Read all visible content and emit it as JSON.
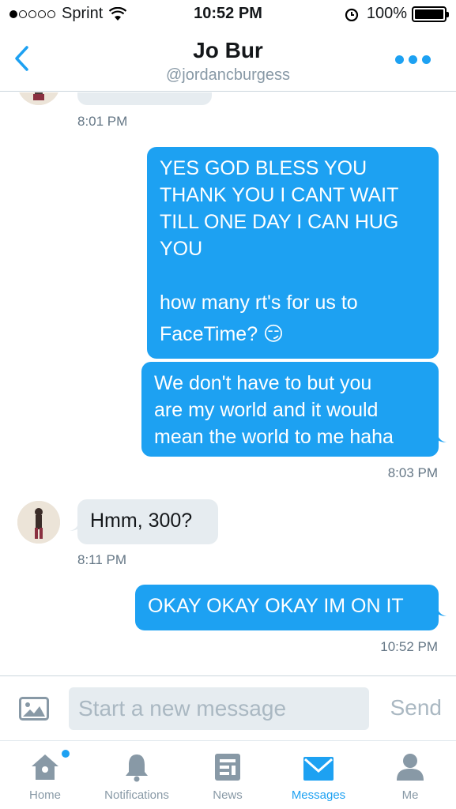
{
  "status_bar": {
    "carrier": "Sprint",
    "time": "10:52 PM",
    "battery": "100%"
  },
  "header": {
    "name": "Jo Bur",
    "handle": "@jordancburgess"
  },
  "messages": {
    "m0_time": "8:01 PM",
    "m1_line1": "YES GOD BLESS YOU",
    "m1_line2": "THANK YOU I CANT WAIT",
    "m1_line3": "TILL ONE DAY I CAN HUG",
    "m1_line4": "YOU",
    "m1_line5": "how many rt's for us to",
    "m1_line6": "FaceTime? 😏",
    "m2_line1": "We don't have to but you",
    "m2_line2": "are my world and it would",
    "m2_line3": "mean the world to me haha",
    "m2_time": "8:03 PM",
    "m3_text": "Hmm, 300?",
    "m3_time": "8:11 PM",
    "m4_text": "OKAY OKAY OKAY IM ON IT",
    "m4_time": "10:52 PM"
  },
  "compose": {
    "placeholder": "Start a new message",
    "send_label": "Send"
  },
  "tabs": {
    "home": "Home",
    "notifications": "Notifications",
    "news": "News",
    "messages": "Messages",
    "me": "Me"
  },
  "colors": {
    "accent": "#1da1f2",
    "grey_bubble": "#e6ecf0",
    "muted": "#8899a6"
  }
}
